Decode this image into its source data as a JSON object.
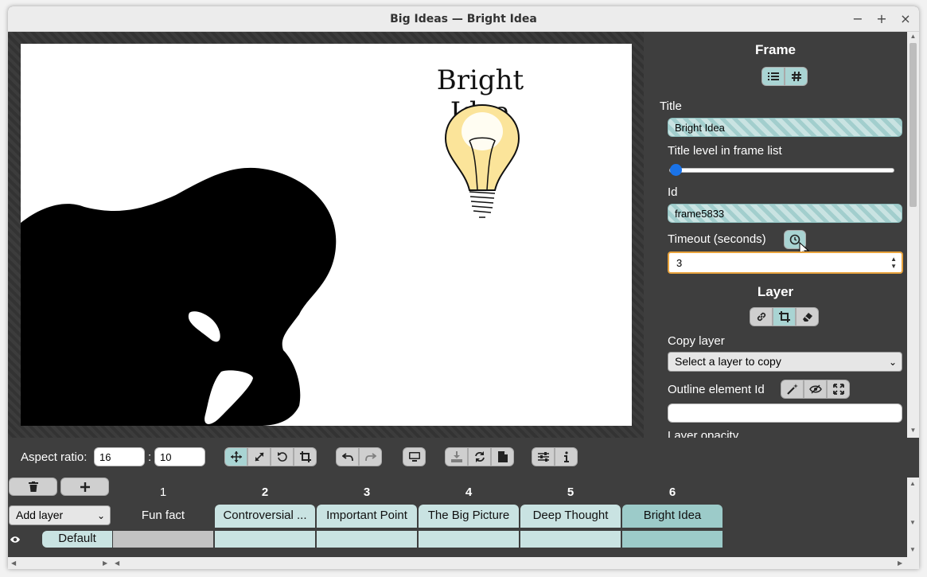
{
  "window": {
    "title": "Big Ideas — Bright Idea",
    "minimize_glyph": "−",
    "maximize_glyph": "+",
    "close_glyph": "×"
  },
  "canvas": {
    "slide_title": "Bright Idea"
  },
  "panel": {
    "frame_heading": "Frame",
    "title_label": "Title",
    "title_value": "Bright Idea",
    "title_level_label": "Title level in frame list",
    "title_level_value": 0,
    "id_label": "Id",
    "id_value": "frame5833",
    "timeout_label": "Timeout (seconds)",
    "timeout_value": "3",
    "layer_heading": "Layer",
    "copy_layer_label": "Copy layer",
    "copy_layer_placeholder": "Select a layer to copy",
    "outline_label": "Outline element Id",
    "outline_value": "",
    "opacity_label": "Layer opacity"
  },
  "toolbar": {
    "aspect_label": "Aspect ratio:",
    "aspect_w": "16",
    "aspect_sep": ":",
    "aspect_h": "10"
  },
  "timeline": {
    "add_layer_label": "Add layer",
    "layer_name": "Default",
    "frames": [
      {
        "num": "1",
        "title": "Fun fact"
      },
      {
        "num": "2",
        "title": "Controversial ..."
      },
      {
        "num": "3",
        "title": "Important Point"
      },
      {
        "num": "4",
        "title": "The Big Picture"
      },
      {
        "num": "5",
        "title": "Deep Thought"
      },
      {
        "num": "6",
        "title": "Bright Idea"
      }
    ]
  },
  "colors": {
    "accent_teal": "#a9d4d3",
    "selected_teal": "#9ccbc9",
    "focus_orange": "#e8a33d",
    "slider_blue": "#1a73e8"
  }
}
